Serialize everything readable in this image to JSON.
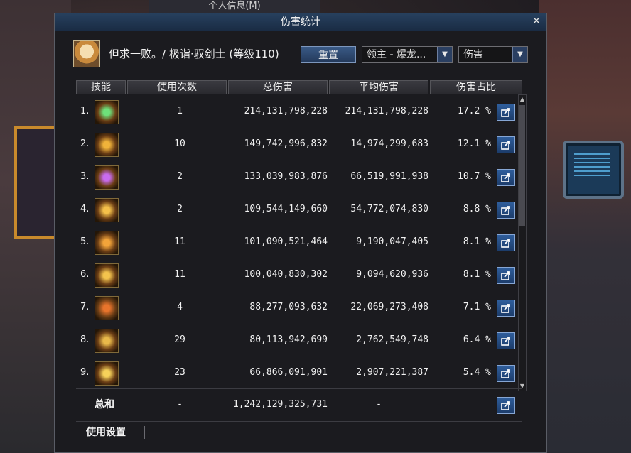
{
  "background": {
    "parent_window_title": "个人信息(M)"
  },
  "dialog": {
    "title": "伤害统计",
    "close": "✕",
    "player_name": "但求一败。/ 极诣·驭剑士 (等级110)",
    "reset_label": "重置",
    "target_select": "领主 - 爆龙...",
    "type_select": "伤害",
    "headers": {
      "skill": "技能",
      "uses": "使用次数",
      "total": "总伤害",
      "avg": "平均伤害",
      "pct": "伤害占比"
    },
    "rows": [
      {
        "rank": "1.",
        "uses": "1",
        "total": "214,131,798,228",
        "avg": "214,131,798,228",
        "pct": "17.2 %"
      },
      {
        "rank": "2.",
        "uses": "10",
        "total": "149,742,996,832",
        "avg": "14,974,299,683",
        "pct": "12.1 %"
      },
      {
        "rank": "3.",
        "uses": "2",
        "total": "133,039,983,876",
        "avg": "66,519,991,938",
        "pct": "10.7 %"
      },
      {
        "rank": "4.",
        "uses": "2",
        "total": "109,544,149,660",
        "avg": "54,772,074,830",
        "pct": "8.8 %"
      },
      {
        "rank": "5.",
        "uses": "11",
        "total": "101,090,521,464",
        "avg": "9,190,047,405",
        "pct": "8.1 %"
      },
      {
        "rank": "6.",
        "uses": "11",
        "total": "100,040,830,302",
        "avg": "9,094,620,936",
        "pct": "8.1 %"
      },
      {
        "rank": "7.",
        "uses": "4",
        "total": "88,277,093,632",
        "avg": "22,069,273,408",
        "pct": "7.1 %"
      },
      {
        "rank": "8.",
        "uses": "29",
        "total": "80,113,942,699",
        "avg": "2,762,549,748",
        "pct": "6.4 %"
      },
      {
        "rank": "9.",
        "uses": "23",
        "total": "66,866,091,901",
        "avg": "2,907,221,387",
        "pct": "5.4 %"
      }
    ],
    "summary": {
      "label": "总和",
      "uses": "-",
      "total": "1,242,129,325,731",
      "avg": "-"
    },
    "footer": {
      "settings_label": "使用设置"
    }
  }
}
